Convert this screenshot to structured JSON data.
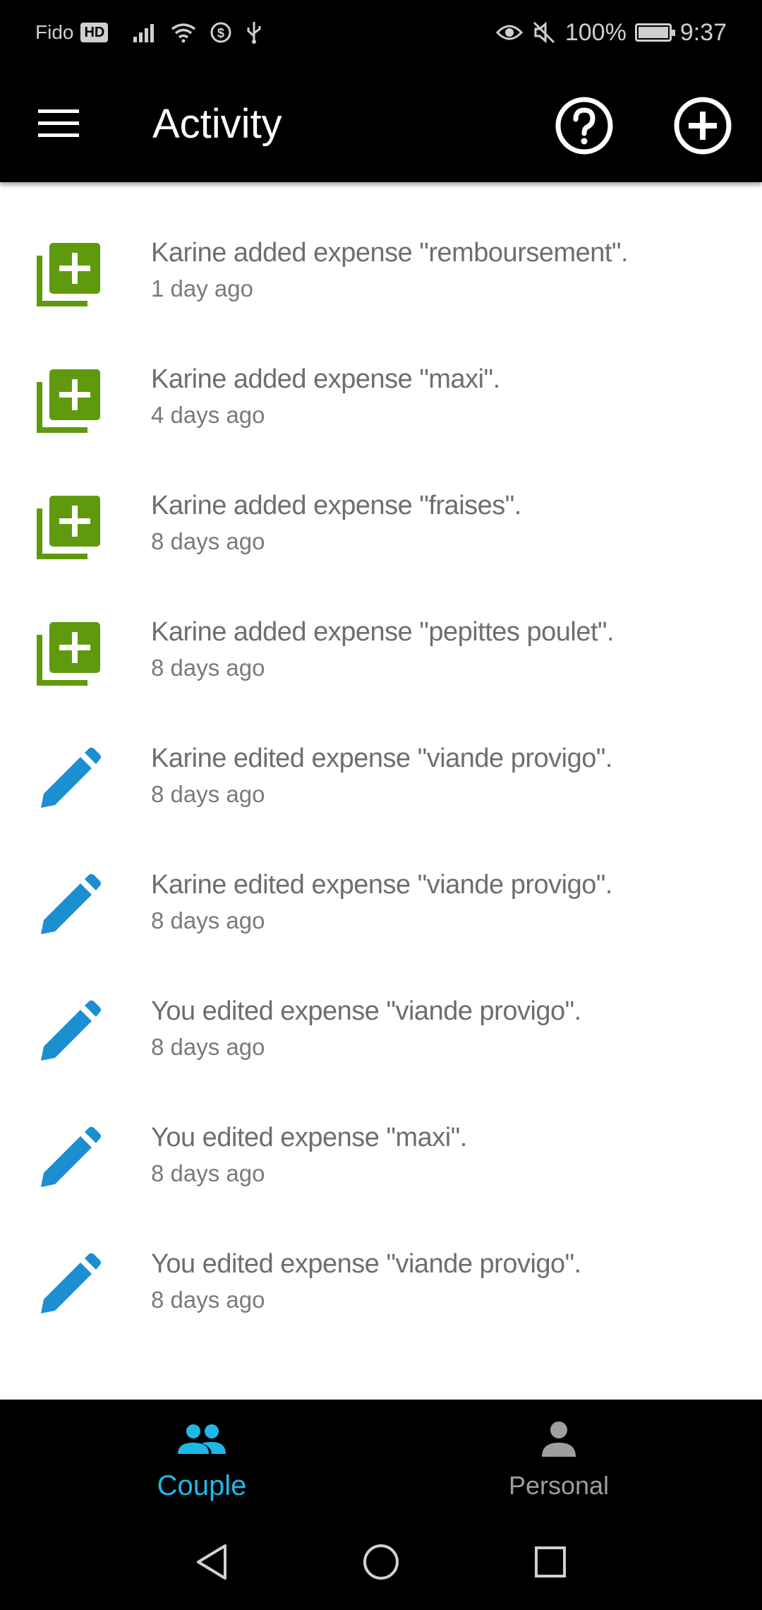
{
  "status_bar": {
    "carrier": "Fido",
    "hd_badge": "HD",
    "battery_percent": "100%",
    "battery_level": 1.0,
    "time": "9:37",
    "icons": [
      "signal-icon",
      "wifi-icon",
      "data-saver-icon",
      "usb-icon",
      "eye-icon",
      "mute-icon",
      "battery-charging-icon"
    ]
  },
  "app_bar": {
    "title": "Activity",
    "menu_icon": "hamburger-menu-icon",
    "help_icon": "help-circle-icon",
    "add_icon": "add-circle-icon"
  },
  "colors": {
    "added_icon": "#5f9a0d",
    "edited_icon": "#1b8fd1",
    "active_tab": "#1eb8e6",
    "inactive_tab": "#9e9e9e",
    "text": "#6e6e6e"
  },
  "activities": [
    {
      "type": "added",
      "icon": "add-box-icon",
      "text": "Karine added expense \"remboursement\".",
      "time": "1 day ago"
    },
    {
      "type": "added",
      "icon": "add-box-icon",
      "text": "Karine added expense \"maxi\".",
      "time": "4 days ago"
    },
    {
      "type": "added",
      "icon": "add-box-icon",
      "text": "Karine added expense \"fraises\".",
      "time": "8 days ago"
    },
    {
      "type": "added",
      "icon": "add-box-icon",
      "text": "Karine added expense \"pepittes poulet\".",
      "time": "8 days ago"
    },
    {
      "type": "edited",
      "icon": "pencil-icon",
      "text": "Karine edited expense \"viande provigo\".",
      "time": "8 days ago"
    },
    {
      "type": "edited",
      "icon": "pencil-icon",
      "text": "Karine edited expense \"viande provigo\".",
      "time": "8 days ago"
    },
    {
      "type": "edited",
      "icon": "pencil-icon",
      "text": "You edited expense \"viande provigo\".",
      "time": "8 days ago"
    },
    {
      "type": "edited",
      "icon": "pencil-icon",
      "text": "You edited expense \"maxi\".",
      "time": "8 days ago"
    },
    {
      "type": "edited",
      "icon": "pencil-icon",
      "text": "You edited expense \"viande provigo\".",
      "time": "8 days ago"
    }
  ],
  "bottom_nav": {
    "tabs": [
      {
        "label": "Couple",
        "icon": "people-icon",
        "active": true
      },
      {
        "label": "Personal",
        "icon": "person-icon",
        "active": false
      }
    ]
  },
  "system_nav": {
    "buttons": [
      "back-icon",
      "home-icon",
      "recents-icon"
    ]
  }
}
